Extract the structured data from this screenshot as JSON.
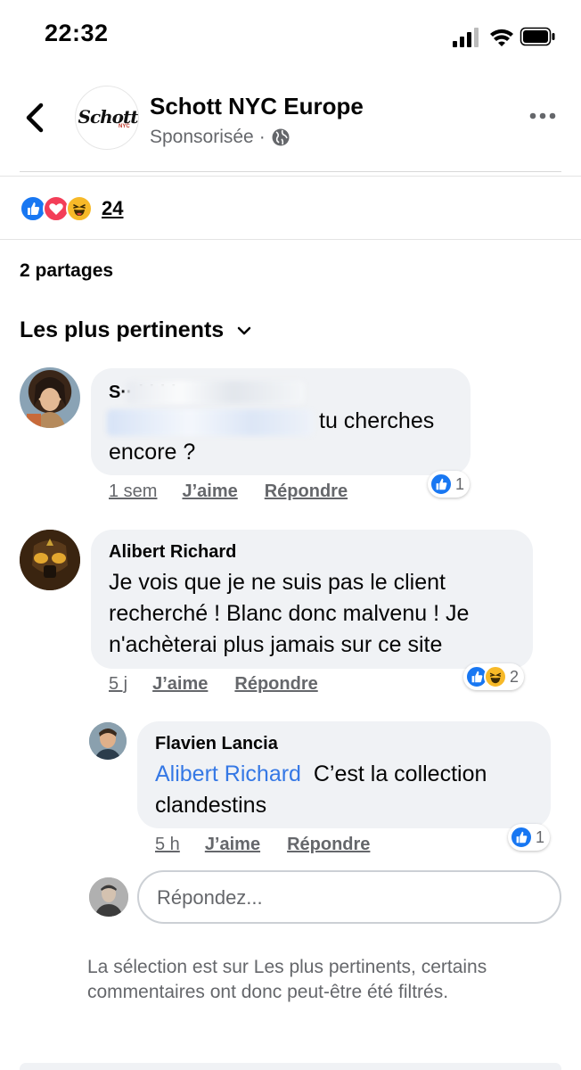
{
  "status_bar": {
    "time": "22:32"
  },
  "post": {
    "page_name": "Schott NYC Europe",
    "sponsored_label": "Sponsorisée",
    "separator": "·",
    "logo_text": "Schott",
    "logo_sub": "NYC",
    "reactions_count": "24",
    "shares_label": "2 partages"
  },
  "comments_section": {
    "sort_label": "Les plus pertinents",
    "comments": [
      {
        "author": "S···bbble",
        "mention": "",
        "text": "tu cherches encore ?",
        "time": "1 sem",
        "like_label": "J’aime",
        "reply_label": "Répondre",
        "reaction_count": "1"
      },
      {
        "author": "Alibert Richard",
        "text": "Je vois que je ne suis pas le client recherché ! Blanc donc malvenu ! Je n'achèterai plus jamais sur ce site",
        "time": "5 j",
        "like_label": "J’aime",
        "reply_label": "Répondre",
        "reaction_count": "2"
      },
      {
        "author": "Flavien Lancia",
        "mention": "Alibert Richard",
        "text": "C’est la collection clandestins",
        "time": "5 h",
        "like_label": "J’aime",
        "reply_label": "Répondre",
        "reaction_count": "1"
      }
    ],
    "reply_placeholder": "Répondez...",
    "filter_note": "La sélection est sur Les plus pertinents, certains commentaires ont donc peut-être été filtrés."
  },
  "colors": {
    "link_blue": "#3578e5",
    "like_blue": "#1877f2",
    "love_red": "#f33e58",
    "haha_yellow": "#f7b928",
    "bubble_gray": "#f0f2f5",
    "meta_gray": "#65676b"
  }
}
